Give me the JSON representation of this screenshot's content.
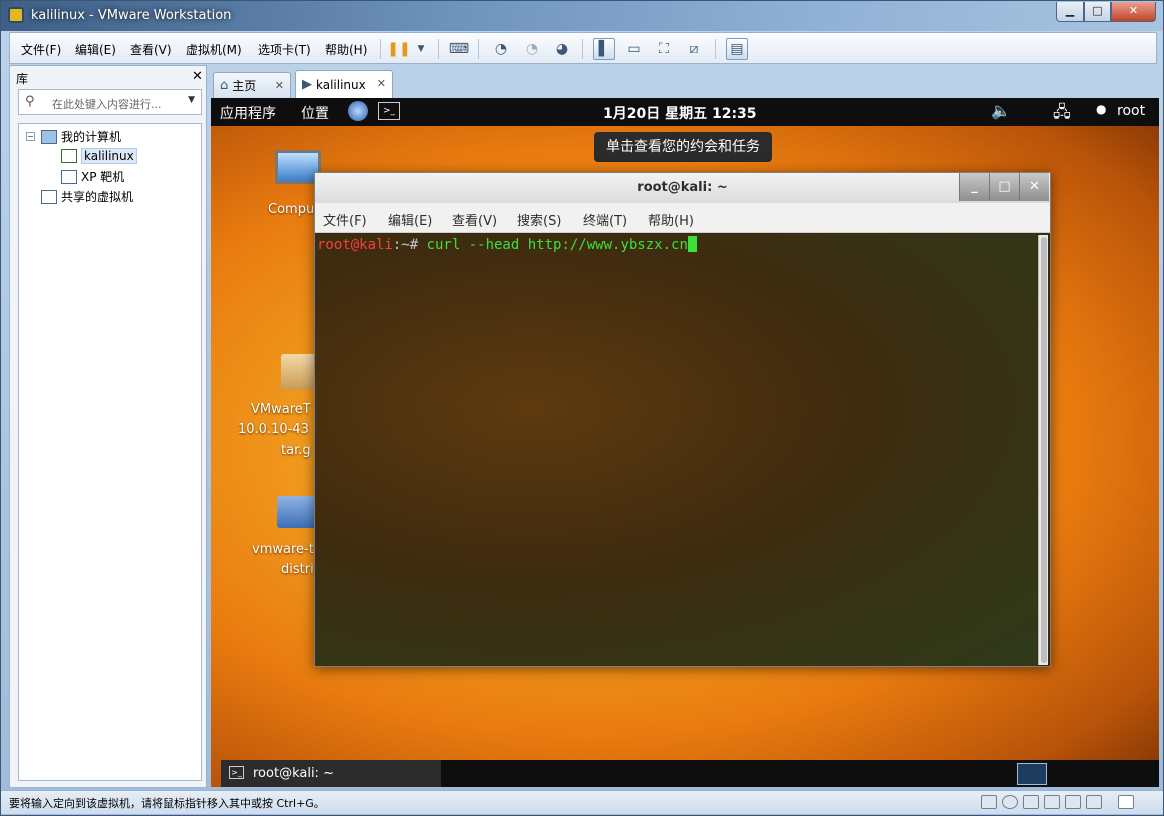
{
  "window": {
    "title": "kalilinux - VMware Workstation",
    "controls": {
      "minimize": "▁",
      "maximize": "□",
      "close": "✕"
    }
  },
  "menubar": {
    "items": [
      "文件(F)",
      "编辑(E)",
      "查看(V)",
      "虚拟机(M)",
      "选项卡(T)",
      "帮助(H)"
    ],
    "toolbar_icons": [
      "pause-icon",
      "dropdown-icon",
      "send-keys-icon",
      "snapshot-icon",
      "revert-snapshot-icon",
      "snapshot-manager-icon",
      "show-library-icon",
      "thumbnail-icon",
      "fullscreen-icon",
      "unity-icon",
      "console-view-icon"
    ]
  },
  "library": {
    "title": "库",
    "close": "✕",
    "search_placeholder": "在此处键入内容进行...",
    "tree": {
      "root": "我的计算机",
      "children": [
        "kalilinux",
        "XP 靶机"
      ],
      "shared": "共享的虚拟机",
      "selected": "kalilinux"
    }
  },
  "tabs": [
    {
      "label": "主页",
      "active": false
    },
    {
      "label": "kalilinux",
      "active": true
    }
  ],
  "vm": {
    "top_panel": {
      "applications": "应用程序",
      "places": "位置",
      "clock": "1月20日 星期五 12:35",
      "user": "root"
    },
    "tooltip": "单击查看您的约会和任务",
    "desktop_icons": [
      {
        "label": "Compu",
        "icon": "computer-icon"
      },
      {
        "label_lines": [
          "VMwareT",
          "10.0.10-43",
          "tar.g"
        ],
        "icon": "package-icon"
      },
      {
        "label_lines": [
          "vmware-t",
          "distri"
        ],
        "icon": "folder-icon"
      }
    ],
    "terminal": {
      "title": "root@kali: ~",
      "menu": [
        "文件(F)",
        "编辑(E)",
        "查看(V)",
        "搜索(S)",
        "终端(T)",
        "帮助(H)"
      ],
      "prompt_user": "root@kali",
      "prompt_path": ":~# ",
      "command": "curl --head http://www.ybszx.cn",
      "controls": {
        "minimize": "_",
        "maximize": "□",
        "close": "✕"
      }
    },
    "bottom_panel": {
      "task_label": "root@kali: ~"
    }
  },
  "statusbar": {
    "text": "要将输入定向到该虚拟机，请将鼠标指针移入其中或按 Ctrl+G。"
  }
}
